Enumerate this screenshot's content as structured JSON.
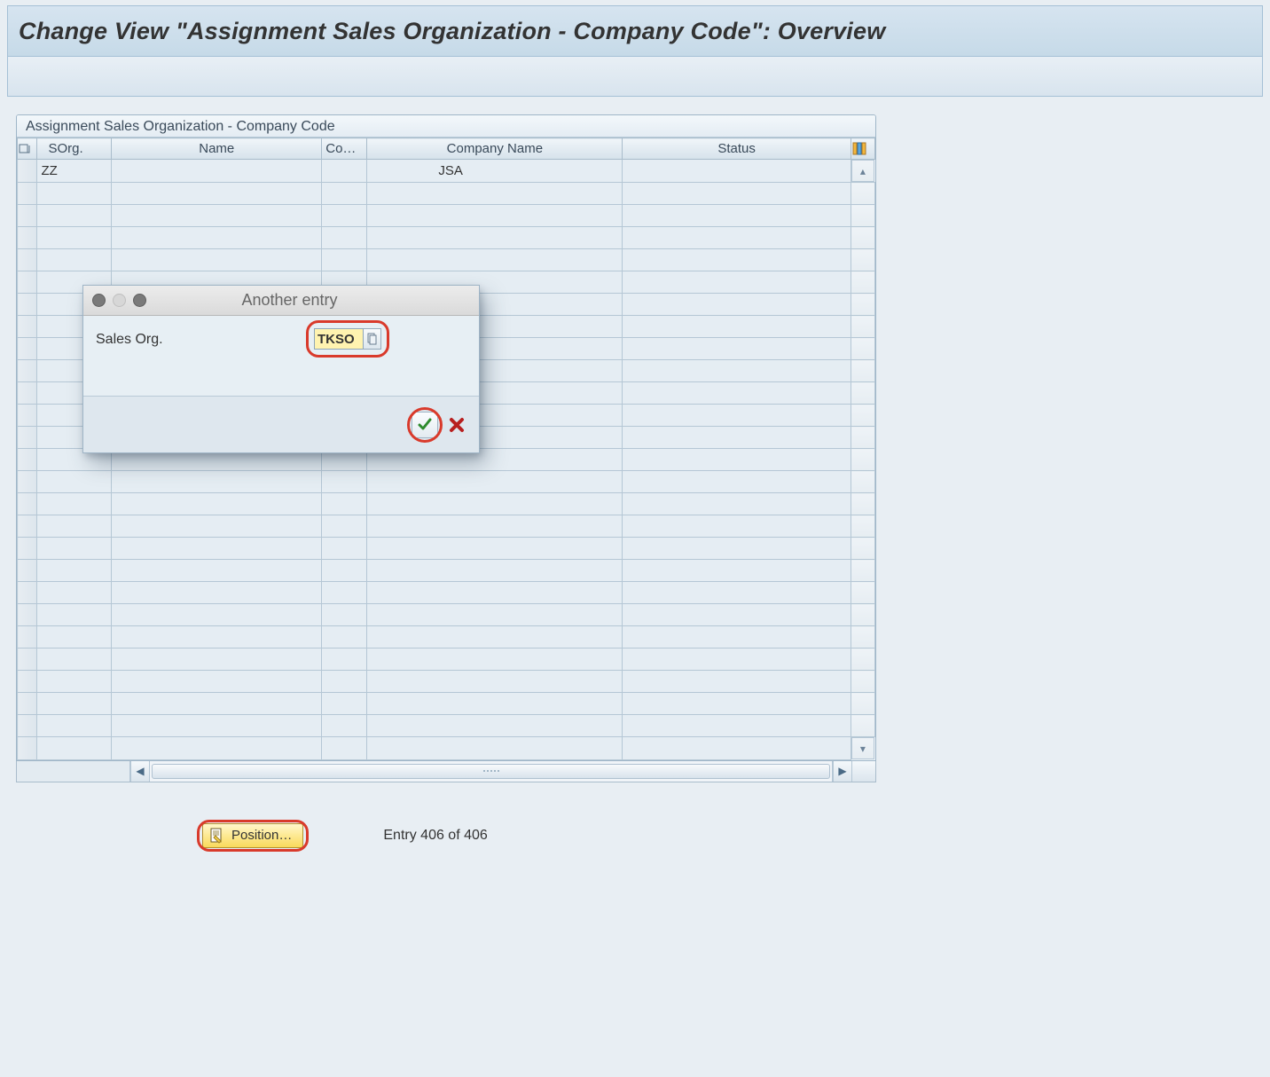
{
  "page_title": "Change View \"Assignment Sales Organization - Company Code\": Overview",
  "table": {
    "title": "Assignment Sales Organization - Company Code",
    "columns": {
      "sorg": "SOrg.",
      "name": "Name",
      "co": "Co…",
      "company_name": "Company Name",
      "status": "Status"
    },
    "rows": [
      {
        "sorg": "ZZ",
        "name": "",
        "co": "",
        "company_name": "JSA",
        "status": ""
      }
    ],
    "empty_row_count": 26
  },
  "modal": {
    "title": "Another entry",
    "field_label": "Sales Org.",
    "field_value": "TKSO"
  },
  "footer": {
    "position_button": "Position…",
    "entry_text": "Entry 406 of 406"
  }
}
